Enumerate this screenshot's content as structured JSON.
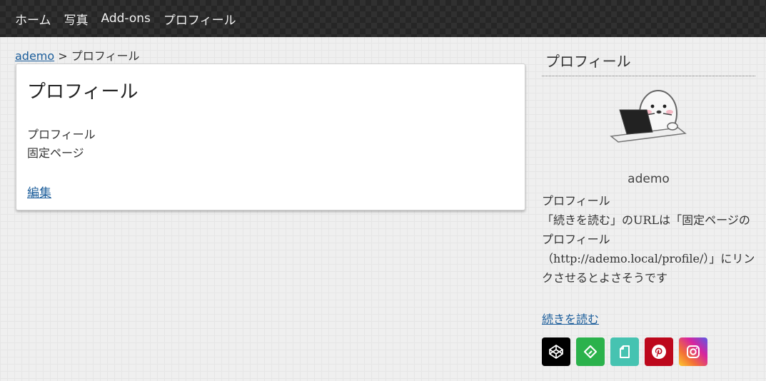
{
  "nav": {
    "items": [
      "ホーム",
      "写真",
      "Add-ons",
      "プロフィール"
    ]
  },
  "breadcrumb": {
    "home": "ademo",
    "separator": ">",
    "current": "プロフィール"
  },
  "page": {
    "title": "プロフィール",
    "line1": "プロフィール",
    "line2": "固定ページ",
    "edit": "編集"
  },
  "sidebar": {
    "widget_title": "プロフィール",
    "author": "ademo",
    "bio": "プロフィール\n「続きを読む」のURLは「固定ページのプロフィール（http://ademo.local/profile/）」にリンクさせるとよさそうです",
    "read_more": "続きを読む"
  },
  "social": [
    {
      "icon": "codepen-icon",
      "color": "#000000"
    },
    {
      "icon": "feedly-icon",
      "color": "#2bb24c"
    },
    {
      "icon": "document-icon",
      "color": "#46c3b1"
    },
    {
      "icon": "pinterest-icon",
      "color": "#bd081c"
    },
    {
      "icon": "instagram-icon",
      "color": "#d6249f"
    }
  ]
}
